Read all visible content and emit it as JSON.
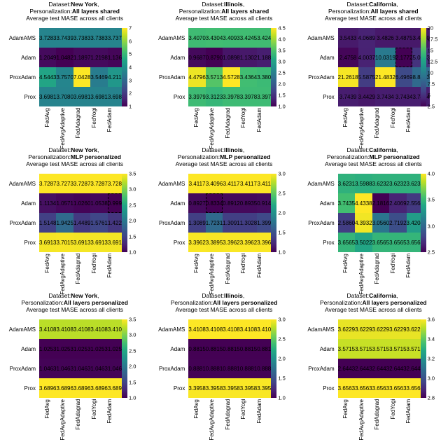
{
  "datasets": [
    "New York",
    "Illinois",
    "California"
  ],
  "personalizations": [
    "All layers shared",
    "MLP personalized",
    "All layers personalized"
  ],
  "subtitle": "Average test MASE across all clients",
  "ylabels": [
    "AdamAMS",
    "Adam",
    "ProxAdam",
    "Prox"
  ],
  "xlabels": [
    "FedAvg",
    "FedAvgAdaptive",
    "FedAdagrad",
    "FedYogi",
    "FedAdam"
  ],
  "viridis_stops": [
    [
      0.0,
      "#440154"
    ],
    [
      0.1,
      "#482475"
    ],
    [
      0.2,
      "#414487"
    ],
    [
      0.3,
      "#355f8d"
    ],
    [
      0.4,
      "#2a788e"
    ],
    [
      0.5,
      "#21918c"
    ],
    [
      0.6,
      "#22a884"
    ],
    [
      0.7,
      "#44bf70"
    ],
    [
      0.8,
      "#7ad151"
    ],
    [
      0.9,
      "#bddf26"
    ],
    [
      1.0,
      "#fde725"
    ]
  ],
  "chart_data": [
    {
      "row": 0,
      "col": 0,
      "title": [
        "Dataset:",
        "New York",
        ", \nPersonalization:",
        "All layers shared"
      ],
      "values": [
        [
          3.7283,
          3.7439,
          3.7383,
          3.7383,
          3.7379
        ],
        [
          1.2049,
          1.0482,
          1.1897,
          1.2198,
          1.1368
        ],
        [
          4.5443,
          3.757,
          7.0428,
          3.5469,
          4.2113
        ],
        [
          3.6981,
          3.708,
          3.6981,
          3.6981,
          3.6981
        ]
      ],
      "cbar": [
        1,
        2,
        3,
        4,
        5,
        6,
        7
      ],
      "highlight": null
    },
    {
      "row": 0,
      "col": 1,
      "title": [
        "Dataset:",
        "Illinois",
        ", \nPersonalization:",
        "All layers shared"
      ],
      "values": [
        [
          3.407,
          3.4304,
          3.4093,
          3.4245,
          3.4242
        ],
        [
          0.9687,
          0.879,
          1.0898,
          1.1302,
          1.188
        ],
        [
          4.4796,
          3.5713,
          4.5728,
          3.4364,
          3.3801
        ],
        [
          3.3979,
          3.3123,
          3.3978,
          3.3978,
          3.3978
        ]
      ],
      "cbar": [
        1.0,
        1.5,
        2.0,
        2.5,
        3.0,
        3.5,
        4.0,
        4.5
      ],
      "highlight": null
    },
    {
      "row": 0,
      "col": 2,
      "title": [
        "Dataset:",
        "California",
        ", \nPersonalization:",
        "All layers shared"
      ],
      "values": [
        [
          3.5433,
          4.0689,
          3.4826,
          3.4875,
          3.485
        ],
        [
          2.4758,
          4.0037,
          10.0319,
          2.1772,
          5.0153
        ],
        [
          21.2618,
          5.5875,
          21.4832,
          6.4969,
          8.8383
        ],
        [
          3.7439,
          3.4429,
          3.7434,
          3.7434,
          3.7434
        ]
      ],
      "cbar": [
        2.5,
        5.0,
        7.5,
        10.0,
        12.5,
        15.0,
        17.5,
        20.0
      ],
      "highlight": [
        1,
        3
      ]
    },
    {
      "row": 1,
      "col": 0,
      "title": [
        "Dataset:",
        "New York",
        ", \nPersonalization:",
        "MLP personalized"
      ],
      "values": [
        [
          3.7287,
          3.7273,
          3.7287,
          3.7287,
          3.7287
        ],
        [
          1.1134,
          1.0571,
          1.026,
          1.0538,
          0.9996
        ],
        [
          1.5148,
          1.9425,
          1.4489,
          1.5761,
          1.4228
        ],
        [
          3.6913,
          3.7015,
          3.6913,
          3.6913,
          3.6913
        ]
      ],
      "cbar": [
        1.0,
        1.5,
        2.0,
        2.5,
        3.0,
        3.5
      ],
      "highlight": [
        1,
        4
      ]
    },
    {
      "row": 1,
      "col": 1,
      "title": [
        "Dataset:",
        "Illinois",
        ", \nPersonalization:",
        "MLP personalized"
      ],
      "values": [
        [
          3.4117,
          3.4096,
          3.4117,
          3.4117,
          3.4117
        ],
        [
          0.8927,
          0.8334,
          0.8912,
          0.8935,
          0.9145
        ],
        [
          1.3089,
          1.7231,
          1.3091,
          1.3028,
          1.3997
        ],
        [
          3.3962,
          3.3895,
          3.3962,
          3.3962,
          3.3962
        ]
      ],
      "cbar": [
        1.0,
        1.5,
        2.0,
        2.5,
        3.0
      ],
      "highlight": [
        1,
        1
      ]
    },
    {
      "row": 1,
      "col": 2,
      "title": [
        "Dataset:",
        "California",
        ", \nPersonalization:",
        "MLP personalized"
      ],
      "values": [
        [
          3.6231,
          3.5988,
          3.6232,
          3.6232,
          3.6232
        ],
        [
          3.7435,
          4.4338,
          2.1816,
          2.4069,
          2.5564
        ],
        [
          2.586,
          4.3932,
          3.056,
          2.7192,
          3.4204
        ],
        [
          3.6565,
          3.5022,
          3.6565,
          3.6565,
          3.6565
        ]
      ],
      "cbar": [
        2.5,
        3.0,
        3.5,
        4.0
      ],
      "highlight": null
    },
    {
      "row": 2,
      "col": 0,
      "title": [
        "Dataset:",
        "New York",
        ", \nPersonalization:",
        "All layers personalized"
      ],
      "values": [
        [
          3.4108,
          3.4108,
          3.4108,
          3.4108,
          3.4108
        ],
        [
          1.0253,
          1.0253,
          1.0253,
          1.0253,
          1.0253
        ],
        [
          1.0463,
          1.0463,
          1.0463,
          1.0463,
          1.0463
        ],
        [
          3.6896,
          3.6896,
          3.6896,
          3.6896,
          3.6896
        ]
      ],
      "cbar": [
        1.0,
        1.5,
        2.0,
        2.5,
        3.0,
        3.5
      ],
      "highlight": null
    },
    {
      "row": 2,
      "col": 1,
      "title": [
        "Dataset:",
        "Illinois",
        ", \nPersonalization:",
        "All layers personalized"
      ],
      "values": [
        [
          3.4108,
          3.4108,
          3.4108,
          3.4108,
          3.4108
        ],
        [
          0.8815,
          0.8815,
          0.8815,
          0.8815,
          0.8815
        ],
        [
          0.8881,
          0.8881,
          0.8881,
          0.8881,
          0.8881
        ],
        [
          3.3958,
          3.3958,
          3.3958,
          3.3958,
          3.3958
        ]
      ],
      "cbar": [
        1.0,
        1.5,
        2.0,
        2.5,
        3.0
      ],
      "highlight": null
    },
    {
      "row": 2,
      "col": 2,
      "title": [
        "Dataset:",
        "California",
        ", \nPersonalization:",
        "All layers personalized"
      ],
      "values": [
        [
          3.6229,
          3.6229,
          3.6229,
          3.6229,
          3.6229
        ],
        [
          3.5715,
          3.5715,
          3.5715,
          3.5715,
          3.5715
        ],
        [
          2.6443,
          2.6443,
          2.6443,
          2.6443,
          2.6443
        ],
        [
          3.6563,
          3.6563,
          3.6563,
          3.6563,
          3.6563
        ]
      ],
      "cbar": [
        2.8,
        3.0,
        3.2,
        3.4,
        3.6
      ],
      "highlight": null
    }
  ]
}
